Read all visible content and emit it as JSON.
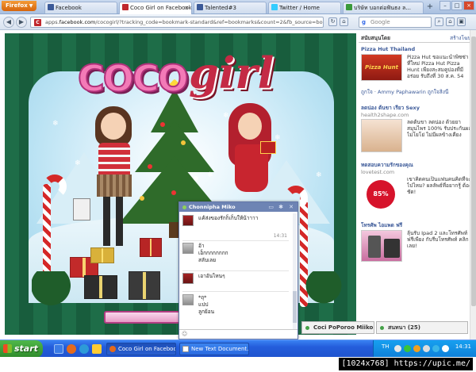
{
  "browser": {
    "menu_button": "Firefox",
    "tabs": [
      {
        "label": "Facebook",
        "icon": "facebook-icon",
        "color": "#3b5998"
      },
      {
        "label": "Coco Girl on Facebook",
        "icon": "cocogirl-icon",
        "color": "#c0282d",
        "active": true
      },
      {
        "label": "Talented#3",
        "icon": "facebook-icon",
        "color": "#3b5998"
      },
      {
        "label": "Twitter / Home",
        "icon": "twitter-icon",
        "color": "#33ccff"
      },
      {
        "label": "บริษัท บอกต่อฟันธง ล...",
        "icon": "site-icon",
        "color": "#3a9a3a"
      }
    ],
    "new_tab": "+",
    "url_prefix": "apps.",
    "url_domain": "facebook.com",
    "url_rest": "/cocogirl/?tracking_code=bookmark-standard&ref=bookmarks&count=2&fb_source=bookmark_apps&f",
    "search_placeholder": "Google"
  },
  "chat": {
    "title": "Chonnipha Miko",
    "messages": [
      {
        "text": "แค้ส่งของรักก็เก็บให้น้าาาา",
        "time": "",
        "avatar": "red"
      },
      {
        "text": "5555",
        "time": "14:31",
        "avatar": ""
      },
      {
        "text": "อ้า\nเอ็กกกกกกกก\nสลับเลย",
        "time": "",
        "avatar": "gray"
      },
      {
        "text": "เอาอันไหนๆ",
        "time": "",
        "avatar": "red"
      },
      {
        "text": "*ถุ*\nแปป\nลูกย้อน",
        "time": "",
        "avatar": "gray"
      }
    ]
  },
  "sidebar": {
    "header": "สนับสนุนโดย",
    "header_more": "สร้างโฆษ",
    "ads": [
      {
        "title": "Pizza Hut Thailand",
        "sub": "",
        "body": "Pizza Hut ขอแนะนำพิซซ่า ที่ใหม่ Pizza Hut Pizza Hunt เพียงสะสมคูปองที่มี อร่อย รับถึงที่ 30 ส.ค. 54",
        "like": "ถูกใจ · Ammy Paphawarin ถูกใจสิ่งนี้",
        "img_color": "#b8281e"
      },
      {
        "title": "ลดน่อง ต้นขา เรียว Sexy",
        "sub": "health2shape.com",
        "body": "ลดต้นขา ลดน่อง ด้วยยาสมุนไพร 100% รับประกันผล ไม่โยโย่ ไม่มีผลข้างเคียง",
        "like": "",
        "img_color": "#d9b28e"
      },
      {
        "title": "ทดสอบความรักของคุณ",
        "sub": "lovetest.com",
        "body": "เขาคิดคนเป็นแฟนคนคิดที่จะ ไปไหม? ผลลัพธ์ที่อยากรู้ ต้องชัด!",
        "like": "",
        "img_color": "#ffffff",
        "percent": "85%"
      },
      {
        "title": "โทรศัพ ไอแพด ฟรี",
        "sub": "",
        "body": "ลุ้นรับ Ipad 2 และโทรศัพท์ ฟรีเพียง กับรีบโทรศัพท์ คลิกเลย!",
        "like": "",
        "img_color": "#e2a7c6"
      }
    ]
  },
  "chat_tabs": [
    {
      "label": "Coci PoPoroo Miiko"
    },
    {
      "label": "สนทนา (25)"
    }
  ],
  "taskbar": {
    "start": "start",
    "tasks": [
      {
        "label": "Coco Girl on Faceboo...",
        "icon_color": "#e46a1c",
        "active": true
      },
      {
        "label": "New Text Document....",
        "icon_color": "#ffffff",
        "active": false
      }
    ],
    "language": "TH",
    "clock": "14:31"
  },
  "watermark": "[1024x768] https://upic.me/"
}
